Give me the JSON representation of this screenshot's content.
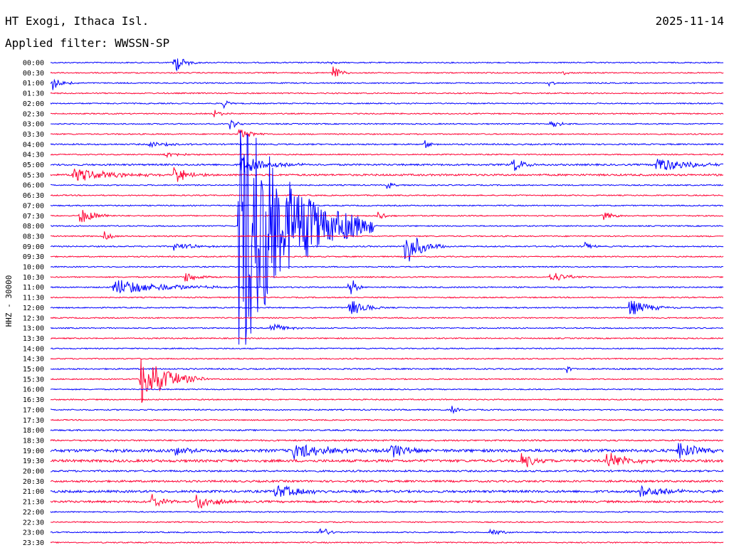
{
  "header": {
    "station": "HT Exogi, Ithaca Isl.",
    "date": "2025-11-14",
    "filter_text": "Applied filter: WWSSN-SP"
  },
  "chart_data": {
    "type": "line",
    "title": "HT Exogi, Ithaca Isl.",
    "ylabel": "HHZ - 30000",
    "trace_colors": [
      "#0000ff",
      "#ff0033"
    ],
    "y_categories": [
      "00:00",
      "00:30",
      "01:00",
      "01:30",
      "02:00",
      "02:30",
      "03:00",
      "03:30",
      "04:00",
      "04:30",
      "05:00",
      "05:30",
      "06:00",
      "06:30",
      "07:00",
      "07:30",
      "08:00",
      "08:30",
      "09:00",
      "09:30",
      "10:00",
      "10:30",
      "11:00",
      "11:30",
      "12:00",
      "12:30",
      "13:00",
      "13:30",
      "14:00",
      "14:30",
      "15:00",
      "15:30",
      "16:00",
      "16:30",
      "17:00",
      "17:30",
      "18:00",
      "18:30",
      "19:00",
      "19:30",
      "20:00",
      "20:30",
      "21:00",
      "21:30",
      "22:00",
      "22:30",
      "23:00",
      "23:30"
    ],
    "x_range_minutes": [
      0,
      30
    ],
    "noise_level": [
      1,
      1,
      1,
      1,
      1,
      1,
      1,
      1,
      1.2,
      1,
      1.5,
      1.6,
      1,
      1,
      1,
      1,
      1,
      1,
      1.1,
      1,
      1,
      1,
      1.1,
      1,
      1,
      1,
      1,
      1,
      1,
      1,
      1.2,
      1,
      1,
      1,
      1.1,
      1,
      1.2,
      1.3,
      2.5,
      2.2,
      1.5,
      1.7,
      2.0,
      1.8,
      1,
      1,
      1,
      1
    ],
    "events": [
      {
        "row": "00:00",
        "t": 5.5,
        "amp": 16,
        "dur": 0.4
      },
      {
        "row": "00:00",
        "t": 12.4,
        "amp": 5,
        "dur": 0.2
      },
      {
        "row": "00:30",
        "t": 12.6,
        "amp": 12,
        "dur": 0.3
      },
      {
        "row": "00:30",
        "t": 22.8,
        "amp": 5,
        "dur": 0.2
      },
      {
        "row": "01:00",
        "t": 0.1,
        "amp": 10,
        "dur": 0.4
      },
      {
        "row": "01:00",
        "t": 22.2,
        "amp": 6,
        "dur": 0.2
      },
      {
        "row": "02:00",
        "t": 7.7,
        "amp": 7,
        "dur": 0.2
      },
      {
        "row": "02:30",
        "t": 7.3,
        "amp": 7,
        "dur": 0.3
      },
      {
        "row": "03:00",
        "t": 8.0,
        "amp": 9,
        "dur": 0.3
      },
      {
        "row": "03:00",
        "t": 22.3,
        "amp": 9,
        "dur": 0.3
      },
      {
        "row": "03:30",
        "t": 8.4,
        "amp": 9,
        "dur": 0.5
      },
      {
        "row": "04:00",
        "t": 16.7,
        "amp": 9,
        "dur": 0.2
      },
      {
        "row": "04:00",
        "t": 4.4,
        "amp": 4,
        "dur": 0.8
      },
      {
        "row": "04:30",
        "t": 5.1,
        "amp": 5,
        "dur": 0.6
      },
      {
        "row": "05:00",
        "t": 8.5,
        "amp": 12,
        "dur": 1.2
      },
      {
        "row": "05:00",
        "t": 20.6,
        "amp": 12,
        "dur": 0.4
      },
      {
        "row": "05:00",
        "t": 27.0,
        "amp": 12,
        "dur": 1.2
      },
      {
        "row": "05:30",
        "t": 1.0,
        "amp": 10,
        "dur": 1.5
      },
      {
        "row": "05:30",
        "t": 5.5,
        "amp": 14,
        "dur": 0.5
      },
      {
        "row": "06:00",
        "t": 15.0,
        "amp": 7,
        "dur": 0.2
      },
      {
        "row": "07:30",
        "t": 1.3,
        "amp": 12,
        "dur": 0.6
      },
      {
        "row": "07:30",
        "t": 14.6,
        "amp": 7,
        "dur": 0.3
      },
      {
        "row": "07:30",
        "t": 24.6,
        "amp": 7,
        "dur": 0.4
      },
      {
        "row": "08:30",
        "t": 2.4,
        "amp": 7,
        "dur": 0.3
      },
      {
        "row": "09:00",
        "t": 15.8,
        "amp": 30,
        "dur": 0.6
      },
      {
        "row": "09:00",
        "t": 5.5,
        "amp": 6,
        "dur": 0.8
      },
      {
        "row": "09:00",
        "t": 23.8,
        "amp": 7,
        "dur": 0.3
      },
      {
        "row": "08:00",
        "t": 8.4,
        "amp": 200,
        "dur": 2.0
      },
      {
        "row": "10:30",
        "t": 6.0,
        "amp": 8,
        "dur": 0.6
      },
      {
        "row": "10:30",
        "t": 22.3,
        "amp": 9,
        "dur": 0.6
      },
      {
        "row": "11:00",
        "t": 2.8,
        "amp": 12,
        "dur": 2.0
      },
      {
        "row": "11:00",
        "t": 13.3,
        "amp": 25,
        "dur": 0.2
      },
      {
        "row": "12:00",
        "t": 13.3,
        "amp": 14,
        "dur": 0.6
      },
      {
        "row": "12:00",
        "t": 25.8,
        "amp": 12,
        "dur": 0.8
      },
      {
        "row": "13:00",
        "t": 9.8,
        "amp": 9,
        "dur": 0.5
      },
      {
        "row": "15:30",
        "t": 4.0,
        "amp": 40,
        "dur": 1.0
      },
      {
        "row": "15:00",
        "t": 23.0,
        "amp": 8,
        "dur": 0.2
      },
      {
        "row": "17:00",
        "t": 17.9,
        "amp": 7,
        "dur": 0.2
      },
      {
        "row": "19:00",
        "t": 5.5,
        "amp": 14,
        "dur": 0.4
      },
      {
        "row": "19:00",
        "t": 10.8,
        "amp": 12,
        "dur": 1.5
      },
      {
        "row": "19:00",
        "t": 15.2,
        "amp": 14,
        "dur": 0.6
      },
      {
        "row": "19:00",
        "t": 28.0,
        "amp": 14,
        "dur": 0.7
      },
      {
        "row": "19:30",
        "t": 21.0,
        "amp": 12,
        "dur": 0.6
      },
      {
        "row": "19:30",
        "t": 24.8,
        "amp": 14,
        "dur": 0.8
      },
      {
        "row": "21:00",
        "t": 10.0,
        "amp": 10,
        "dur": 1.2
      },
      {
        "row": "21:00",
        "t": 26.3,
        "amp": 9,
        "dur": 1.2
      },
      {
        "row": "21:30",
        "t": 4.5,
        "amp": 12,
        "dur": 0.4
      },
      {
        "row": "21:30",
        "t": 6.5,
        "amp": 12,
        "dur": 0.8
      },
      {
        "row": "23:00",
        "t": 12.0,
        "amp": 12,
        "dur": 0.3
      },
      {
        "row": "23:00",
        "t": 19.6,
        "amp": 7,
        "dur": 0.4
      }
    ]
  }
}
